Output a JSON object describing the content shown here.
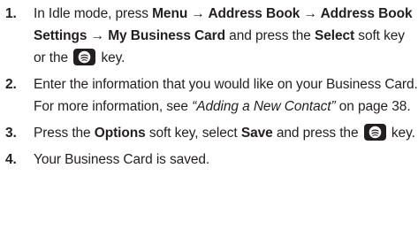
{
  "steps": [
    {
      "number": "1.",
      "t1": "In Idle mode, press ",
      "b1": "Menu",
      "arrow1": " → ",
      "b2": "Address Book",
      "arrow2": " → ",
      "b3": "Address Book Settings",
      "arrow3": " → ",
      "b4": "My Business Card",
      "t2": " and press the ",
      "b5": "Select",
      "t3": " soft key or the ",
      "key_icon": "select-key-icon",
      "t4": " key."
    },
    {
      "number": "2.",
      "t1": "Enter the information that you would like on your Business Card. For more information, see ",
      "ref": "“Adding a New Contact”",
      "t2": " on page 38."
    },
    {
      "number": "3.",
      "t1": " Press the ",
      "b1": "Options",
      "t2": " soft key, select ",
      "b2": "Save",
      "t3": " and press the ",
      "key_icon": "select-key-icon",
      "t4": " key."
    },
    {
      "number": "4.",
      "t1": "Your Business Card is saved."
    }
  ],
  "colors": {
    "text": "#231f20",
    "key_bg": "#231f20",
    "key_fg": "#ffffff"
  }
}
